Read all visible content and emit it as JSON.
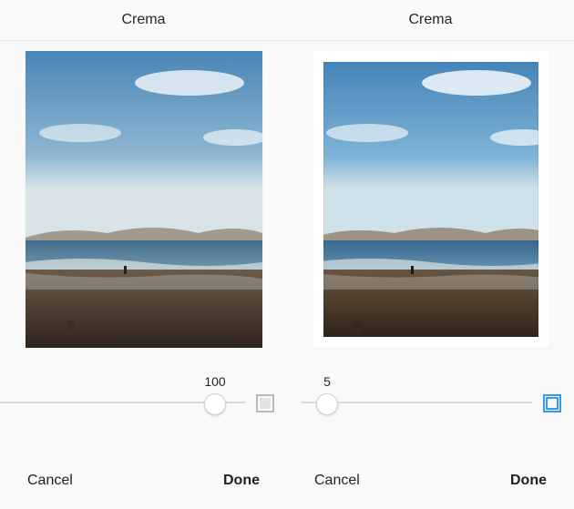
{
  "panels": [
    {
      "title": "Crema",
      "slider_value": "100",
      "slider_percent": 100,
      "frame_enabled": false,
      "cancel_label": "Cancel",
      "done_label": "Done"
    },
    {
      "title": "Crema",
      "slider_value": "5",
      "slider_percent": 5,
      "frame_enabled": true,
      "cancel_label": "Cancel",
      "done_label": "Done"
    }
  ],
  "colors": {
    "accent": "#3897f0",
    "track": "#dbdbdb",
    "text": "#262626"
  }
}
